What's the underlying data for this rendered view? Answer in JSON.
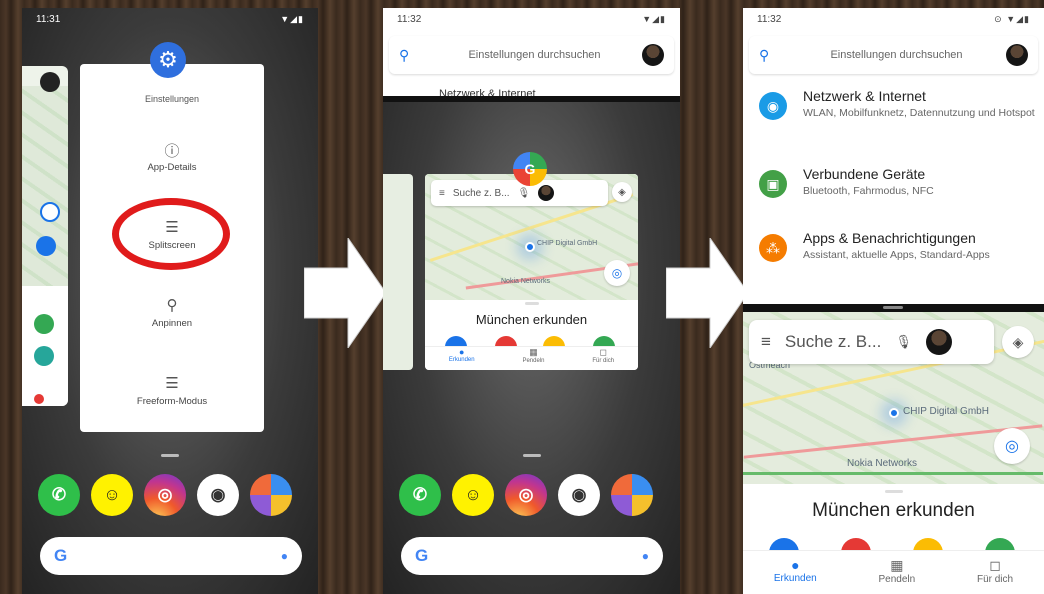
{
  "panel1": {
    "time": "11:31",
    "status_icons": "▼◢▮",
    "menu": {
      "title": "Einstellungen",
      "items": [
        {
          "label": "App-Details",
          "icon": "info-icon"
        },
        {
          "label": "Splitscreen",
          "icon": "splitscreen-icon"
        },
        {
          "label": "Anpinnen",
          "icon": "pin-icon"
        },
        {
          "label": "Freeform-Modus",
          "icon": "freeform-icon"
        }
      ]
    },
    "dock_apps": [
      "WhatsApp",
      "Snapchat",
      "Instagram",
      "Kamera",
      "Ordner"
    ],
    "search_logo": "G",
    "highlight_color": "#e01b1b"
  },
  "panel2": {
    "time": "11:32",
    "status_icons": "▼◢▮",
    "search_placeholder": "Einstellungen durchsuchen",
    "peek_text": "Netzwerk & Internet",
    "maps": {
      "search_placeholder": "Suche z. B...",
      "place_chip": "CHIP Digital GmbH",
      "place_nokia": "Nokia Networks",
      "sheet_title": "München erkunden",
      "nav": [
        "Erkunden",
        "Pendeln",
        "Für dich"
      ]
    },
    "search_logo": "G"
  },
  "panel3": {
    "time": "11:32",
    "status_icons": "⊙ ▼◢▮",
    "search_placeholder": "Einstellungen durchsuchen",
    "settings": [
      {
        "title": "Netzwerk & Internet",
        "subtitle": "WLAN, Mobilfunknetz, Datennutzung und Hotspot",
        "color": "#1a9be6",
        "icon": "wifi-icon"
      },
      {
        "title": "Verbundene Geräte",
        "subtitle": "Bluetooth, Fahrmodus, NFC",
        "color": "#43a047",
        "icon": "devices-icon"
      },
      {
        "title": "Apps & Benachrichtigungen",
        "subtitle": "Assistant, aktuelle Apps, Standard-Apps",
        "color": "#f57c00",
        "icon": "apps-icon"
      }
    ],
    "maps": {
      "search_placeholder": "Suche z. B...",
      "place_chip": "CHIP Digital GmbH",
      "place_nokia": "Nokia Networks",
      "place_osten": "Ostmeacn",
      "sheet_title": "München erkunden",
      "nav": [
        "Erkunden",
        "Pendeln",
        "Für dich"
      ]
    }
  }
}
